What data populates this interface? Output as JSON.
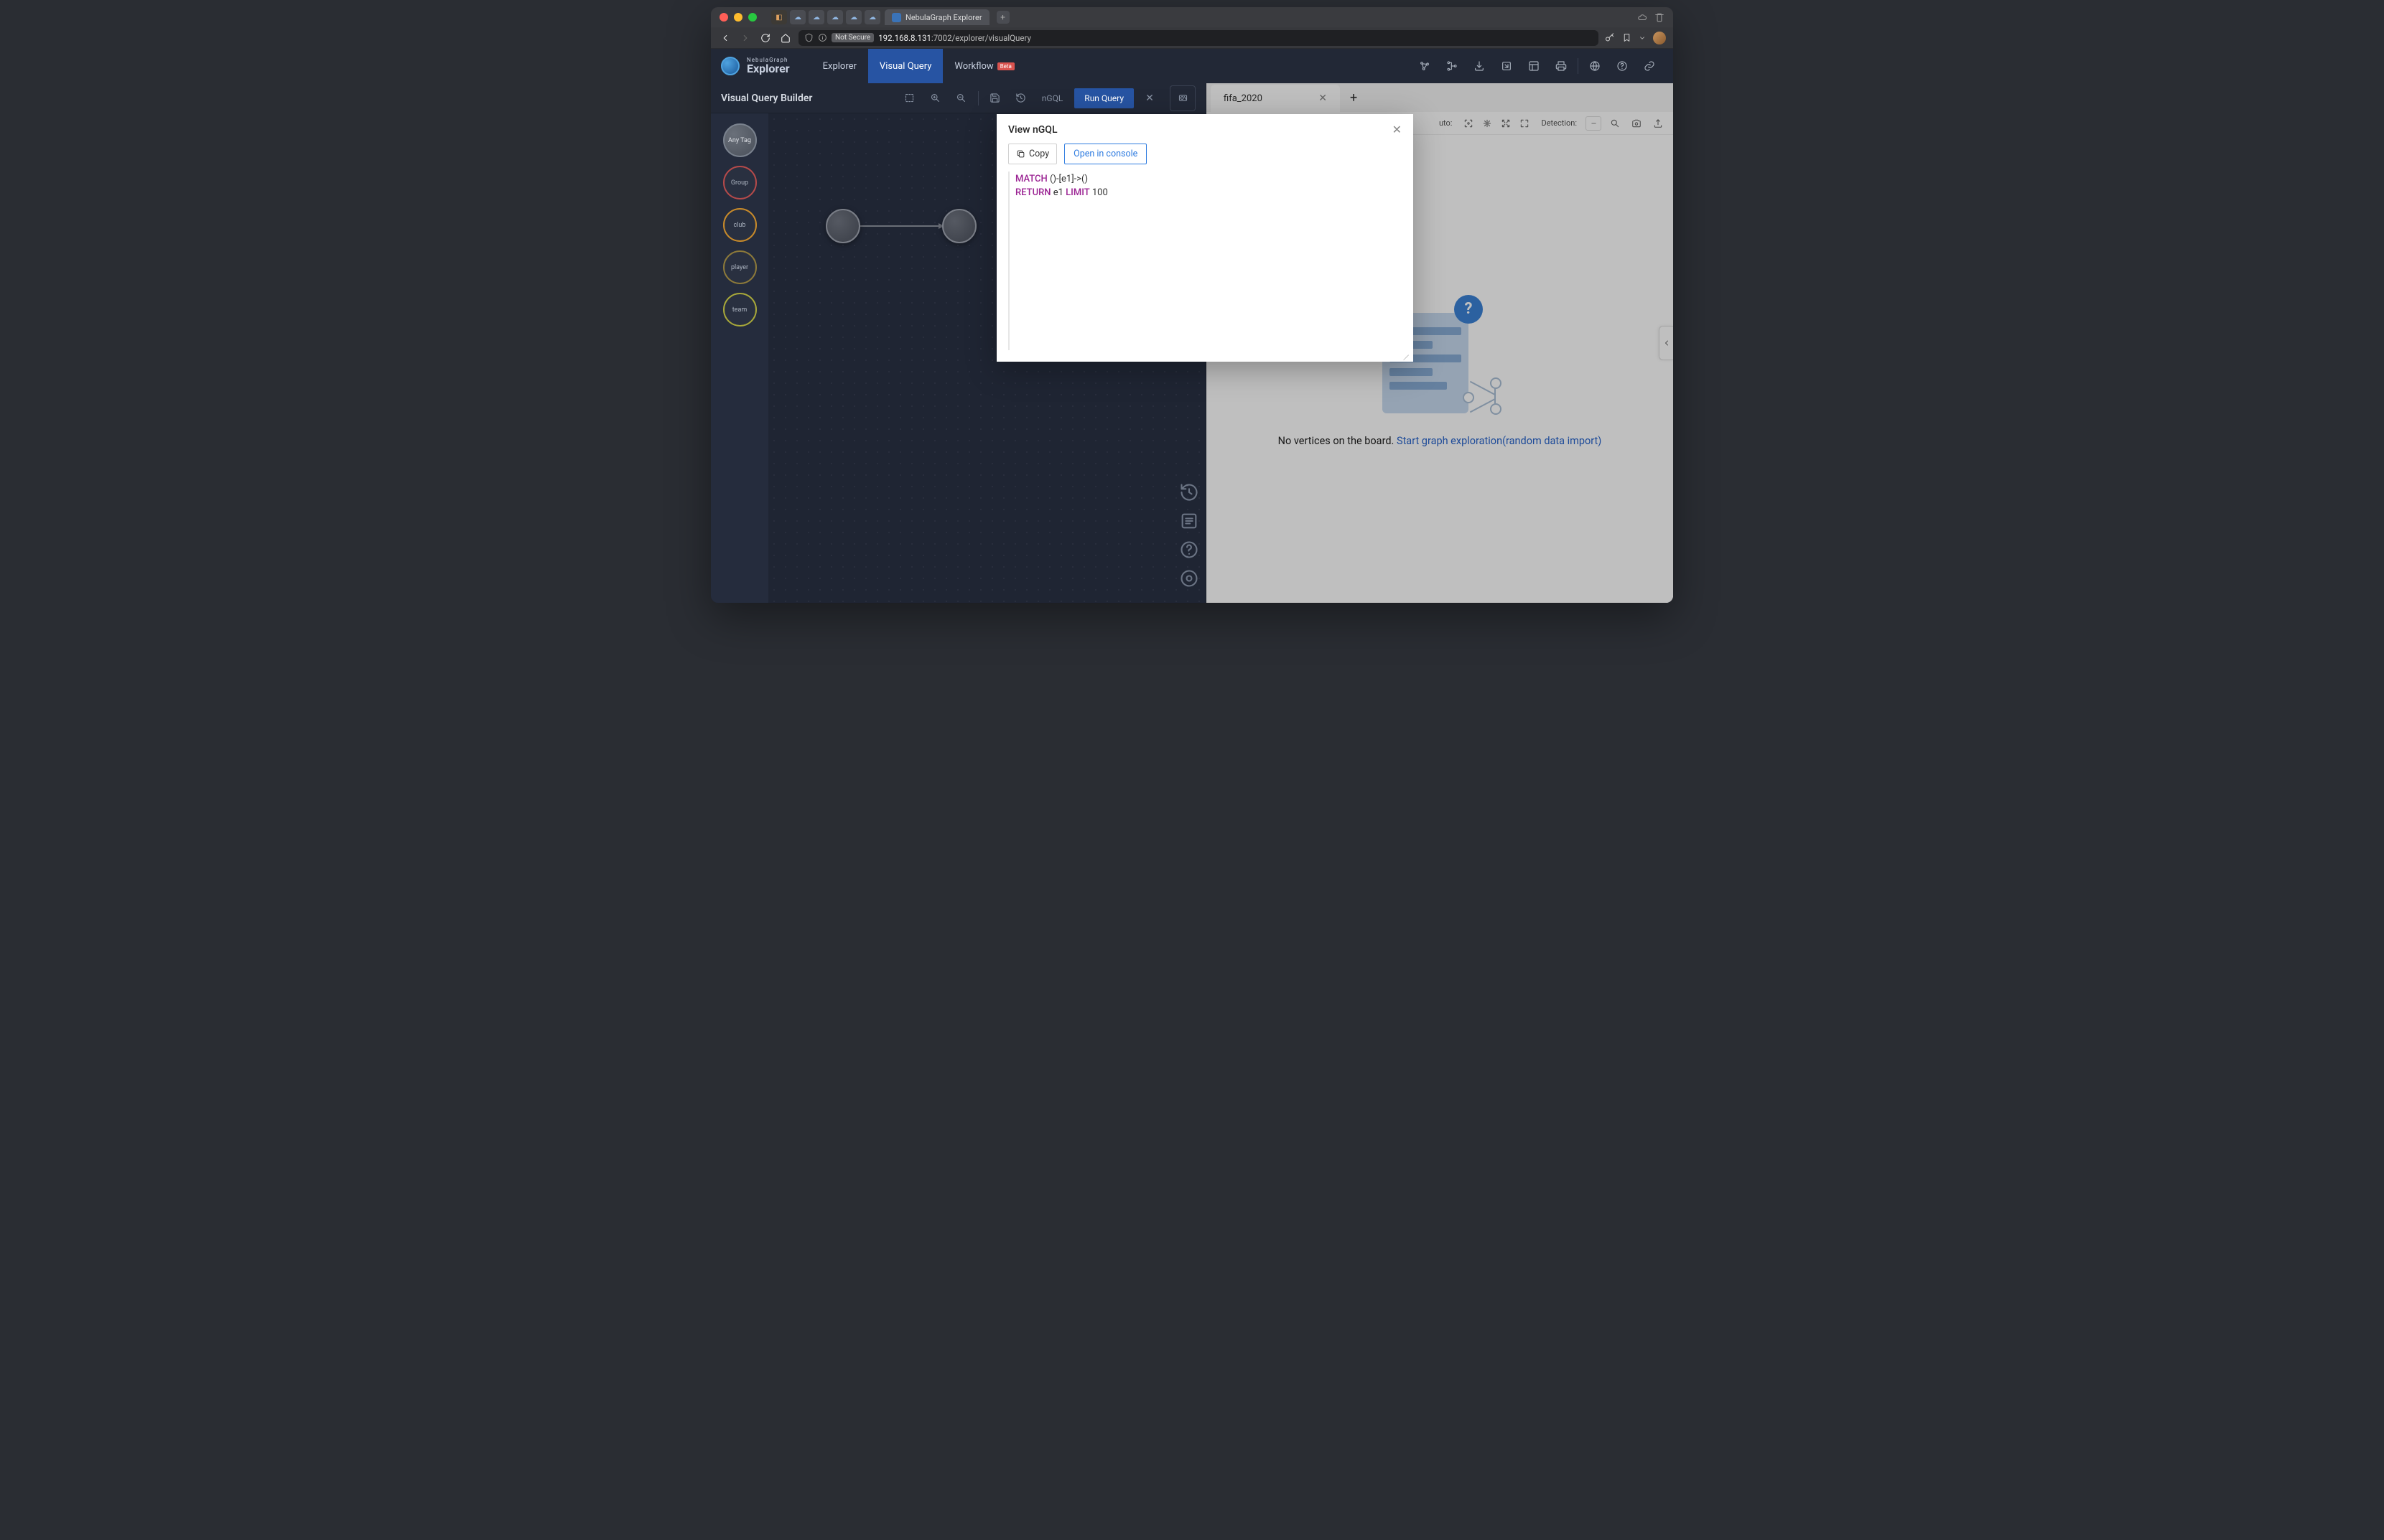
{
  "browser": {
    "tab_title": "NebulaGraph Explorer",
    "not_secure": "Not Secure",
    "url_host": "192.168.8.131",
    "url_port_path": ":7002/explorer/visualQuery"
  },
  "app": {
    "brand_sub": "NebulaGraph",
    "brand_main": "Explorer",
    "nav": {
      "explorer": "Explorer",
      "visual_query": "Visual Query",
      "workflow": "Workflow",
      "beta": "Beta"
    }
  },
  "vqb": {
    "title": "Visual Query Builder",
    "ngql": "nGQL",
    "run_query": "Run Query",
    "tags": {
      "any": "Any Tag",
      "group": "Group",
      "club": "club",
      "player": "player",
      "team": "team"
    }
  },
  "results": {
    "tab_name": "fifa_2020",
    "auto_label": "uto:",
    "detection_label": "Detection:",
    "empty_text": "No vertices on the board. ",
    "empty_link": "Start graph exploration(random data import)"
  },
  "modal": {
    "title": "View nGQL",
    "copy_label": "Copy",
    "console_label": "Open in console",
    "code_kw1": "MATCH",
    "code_seg1": " ()-[e1]->()",
    "code_kw2": "RETURN",
    "code_seg2": " e1 ",
    "code_kw3": "LIMIT",
    "code_seg3": " 100"
  }
}
